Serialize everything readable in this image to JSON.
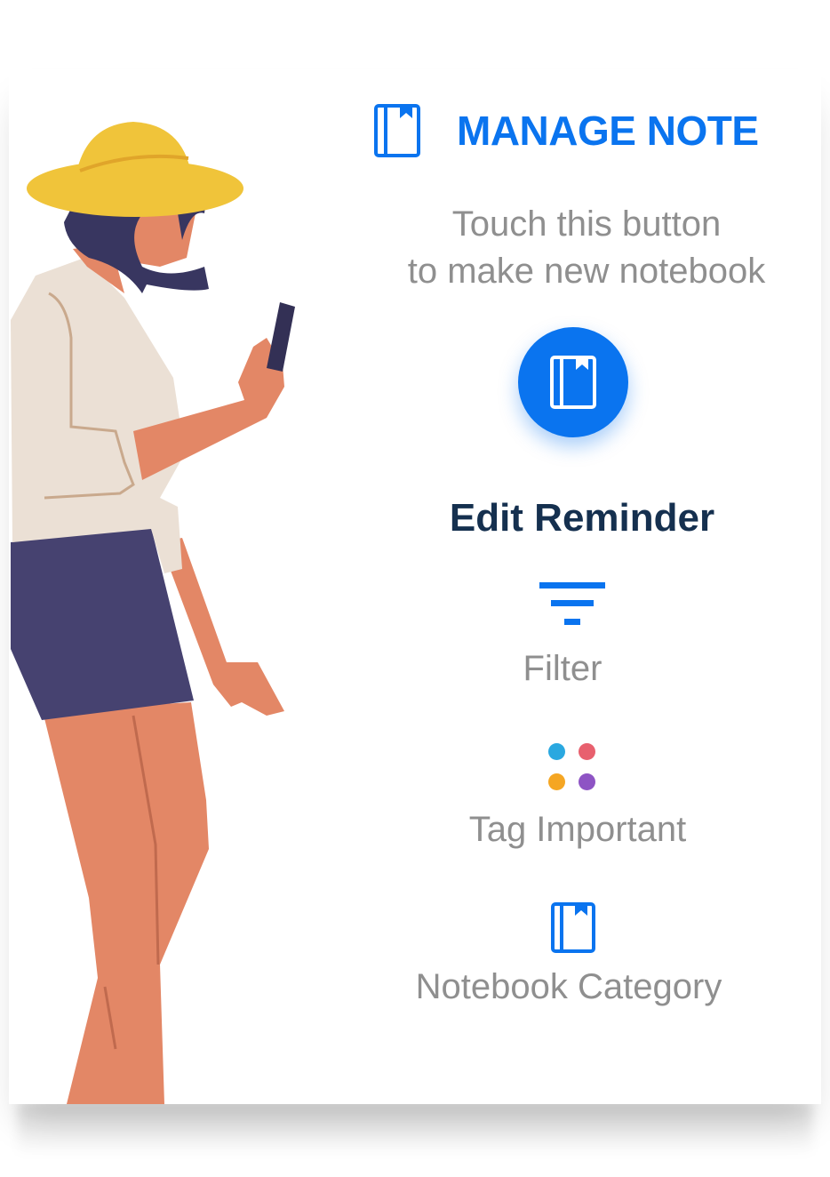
{
  "header": {
    "title": "MANAGE NOTE",
    "icon": "notebook-icon",
    "accent_color": "#0a74ef"
  },
  "intro": {
    "line1": "Touch this button",
    "line2": "to make new notebook"
  },
  "new_notebook_button": {
    "icon": "notebook-icon"
  },
  "section": {
    "title": "Edit Reminder"
  },
  "features": [
    {
      "label": "Filter",
      "icon": "filter-icon"
    },
    {
      "label": "Tag Important",
      "icon": "tag-dots-icon",
      "colors": [
        "#2aa8e0",
        "#e8606e",
        "#f5a623",
        "#8e54c4"
      ]
    },
    {
      "label": "Notebook Category",
      "icon": "notebook-icon"
    }
  ]
}
